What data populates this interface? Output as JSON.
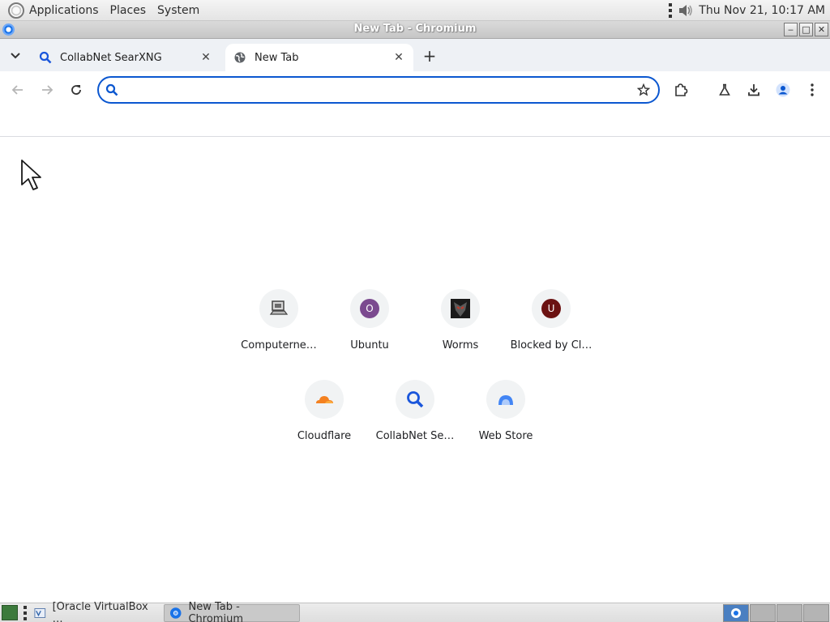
{
  "panel": {
    "menus": [
      "Applications",
      "Places",
      "System"
    ],
    "clock": "Thu Nov 21, 10:17 AM"
  },
  "window": {
    "title": "New Tab - Chromium",
    "buttons": [
      "minimize",
      "maximize",
      "close"
    ]
  },
  "tabs": [
    {
      "title": "CollabNet SearXNG",
      "icon": "search-icon",
      "active": false
    },
    {
      "title": "New Tab",
      "icon": "globe-icon",
      "active": true
    }
  ],
  "toolbar": {
    "omnibox_value": "",
    "omnibox_placeholder": ""
  },
  "shortcuts": [
    {
      "label": "Computerne…",
      "icon": "computer-icon"
    },
    {
      "label": "Ubuntu",
      "letter": "O",
      "color": "#7b4a8f"
    },
    {
      "label": "Worms",
      "icon": "worms-icon"
    },
    {
      "label": "Blocked by Cl…",
      "letter": "U",
      "color": "#6b1212"
    },
    {
      "label": "Cloudflare",
      "icon": "cloudflare-icon",
      "color": "#f48120"
    },
    {
      "label": "CollabNet Se…",
      "icon": "search-icon",
      "color": "#1a56db"
    },
    {
      "label": "Web Store",
      "icon": "webstore-icon",
      "color": "#4285f4"
    }
  ],
  "taskbar": {
    "items": [
      {
        "label": "[Oracle VirtualBox …",
        "active": false
      },
      {
        "label": "New Tab - Chromium",
        "active": true
      }
    ],
    "workspaces": 4,
    "current_workspace": 1
  },
  "colors": {
    "accent": "#0b57d0",
    "tab_strip": "#eef1f5"
  }
}
